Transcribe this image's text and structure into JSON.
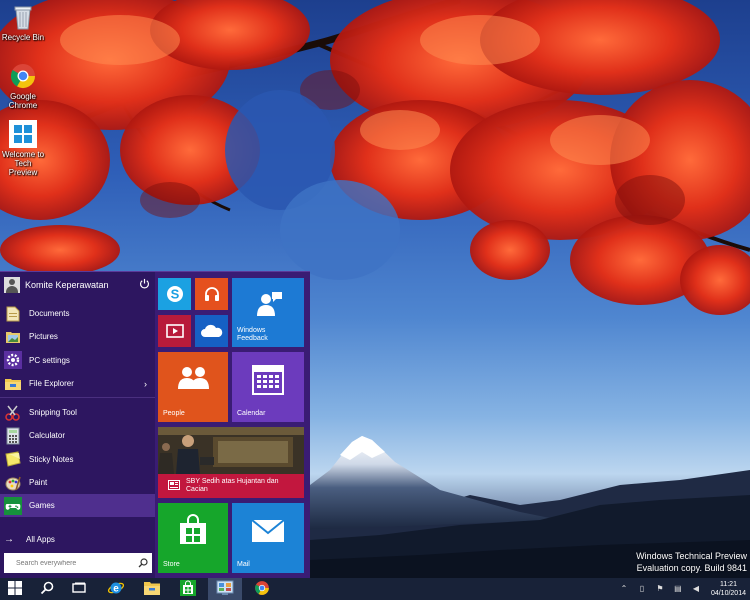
{
  "desktop": {
    "icons": [
      {
        "name": "recycle-bin",
        "label": "Recycle Bin"
      },
      {
        "name": "google-chrome",
        "label": "Google Chrome"
      },
      {
        "name": "welcome-tech-preview",
        "label": "Welcome to Tech Preview"
      }
    ],
    "watermark": {
      "line1": "Windows Technical Preview",
      "line2": "Evaluation copy. Build 9841"
    }
  },
  "start_menu": {
    "user": {
      "name": "Komite Keperawatan",
      "power_icon": "power-icon"
    },
    "places": [
      {
        "label": "Documents",
        "icon": "documents-icon"
      },
      {
        "label": "Pictures",
        "icon": "pictures-icon"
      },
      {
        "label": "PC settings",
        "icon": "gear-icon"
      },
      {
        "label": "File Explorer",
        "icon": "file-explorer-icon",
        "has_submenu": true
      }
    ],
    "apps": [
      {
        "label": "Snipping Tool",
        "icon": "snipping-tool-icon"
      },
      {
        "label": "Calculator",
        "icon": "calculator-icon"
      },
      {
        "label": "Sticky Notes",
        "icon": "sticky-notes-icon"
      },
      {
        "label": "Paint",
        "icon": "paint-icon"
      },
      {
        "label": "Games",
        "icon": "games-icon",
        "highlighted": true
      }
    ],
    "all_apps_label": "All Apps",
    "search": {
      "placeholder": "Search everywhere",
      "value": ""
    },
    "tiles": {
      "skype": {
        "label": ""
      },
      "music": {
        "label": ""
      },
      "video": {
        "label": ""
      },
      "onedrive": {
        "label": ""
      },
      "windows_feedback": {
        "label_line1": "Windows",
        "label_line2": "Feedback"
      },
      "people": {
        "label": "People"
      },
      "calendar": {
        "label": "Calendar"
      },
      "news": {
        "label_line1": "SBY Sedih atas Hujantan dan",
        "label_line2": "Cacian"
      },
      "store": {
        "label": "Store"
      },
      "mail": {
        "label": "Mail"
      }
    },
    "colors": {
      "skype": "#1ba1e2",
      "music": "#e5501e",
      "video": "#b81b3b",
      "onedrive": "#1660c4",
      "feedback": "#1d7ad4",
      "people": "#e0541c",
      "calendar": "#6c3bbd",
      "news": "#c2173e",
      "store": "#16a62b",
      "mail": "#1c83d6"
    }
  },
  "taskbar": {
    "buttons": [
      {
        "name": "start-button",
        "icon": "windows-logo-icon"
      },
      {
        "name": "search-button",
        "icon": "search-icon"
      },
      {
        "name": "task-view-button",
        "icon": "task-view-icon"
      },
      {
        "name": "internet-explorer-button",
        "icon": "internet-explorer-icon"
      },
      {
        "name": "file-explorer-button",
        "icon": "folder-icon"
      },
      {
        "name": "store-button",
        "icon": "store-icon"
      },
      {
        "name": "control-panel-button",
        "icon": "control-panel-icon"
      },
      {
        "name": "chrome-button",
        "icon": "chrome-icon"
      }
    ],
    "clock": {
      "time": "11:21",
      "date": "04/10/2014"
    }
  }
}
